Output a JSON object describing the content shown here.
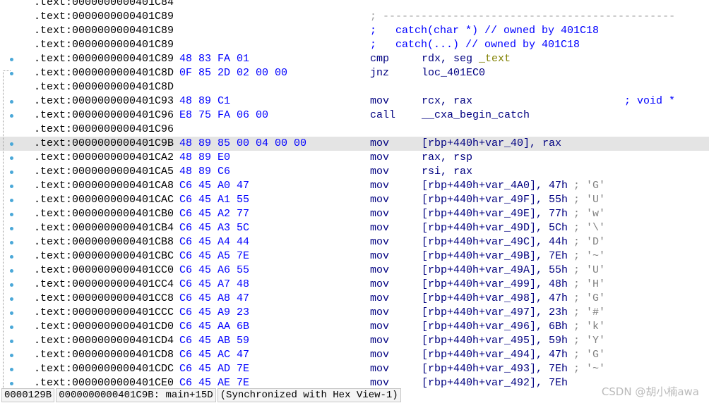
{
  "lines": [
    {
      "addr": ".text:0000000000401C84"
    },
    {
      "addr": ".text:0000000000401C89",
      "separator": "; ----------------------------------------------"
    },
    {
      "addr": ".text:0000000000401C89",
      "comment": ";   catch(char *) // owned by 401C18"
    },
    {
      "addr": ".text:0000000000401C89",
      "comment": ";   catch(...) // owned by 401C18"
    },
    {
      "addr": ".text:0000000000401C89",
      "bytes": "48 83 FA 01",
      "mnem": "cmp",
      "op1": "rdx, seg ",
      "op2": "_text",
      "bp": true
    },
    {
      "addr": ".text:0000000000401C8D",
      "bytes": "0F 85 2D 02 00 00",
      "mnem": "jnz",
      "op1": "loc_401EC0",
      "bp": true
    },
    {
      "addr": ".text:0000000000401C8D"
    },
    {
      "addr": ".text:0000000000401C93",
      "bytes": "48 89 C1",
      "mnem": "mov",
      "op1": "rcx, rax",
      "rcomment": "; void *",
      "bp": true
    },
    {
      "addr": ".text:0000000000401C96",
      "bytes": "E8 75 FA 06 00",
      "mnem": "call",
      "op1": "__cxa_begin_catch",
      "bp": true
    },
    {
      "addr": ".text:0000000000401C96"
    },
    {
      "addr": ".text:0000000000401C9B",
      "bytes": "48 89 85 00 04 00 00",
      "mnem": "mov",
      "op1": "[rbp+440h+var_40], rax",
      "bp": true,
      "selected": true
    },
    {
      "addr": ".text:0000000000401CA2",
      "bytes": "48 89 E0",
      "mnem": "mov",
      "op1": "rax, rsp",
      "bp": true
    },
    {
      "addr": ".text:0000000000401CA5",
      "bytes": "48 89 C6",
      "mnem": "mov",
      "op1": "rsi, rax",
      "bp": true
    },
    {
      "addr": ".text:0000000000401CA8",
      "bytes": "C6 45 A0 47",
      "mnem": "mov",
      "op1": "[rbp+440h+var_4A0], 47h",
      "ccomment": "; 'G'",
      "bp": true
    },
    {
      "addr": ".text:0000000000401CAC",
      "bytes": "C6 45 A1 55",
      "mnem": "mov",
      "op1": "[rbp+440h+var_49F], 55h",
      "ccomment": "; 'U'",
      "bp": true
    },
    {
      "addr": ".text:0000000000401CB0",
      "bytes": "C6 45 A2 77",
      "mnem": "mov",
      "op1": "[rbp+440h+var_49E], 77h",
      "ccomment": "; 'w'",
      "bp": true
    },
    {
      "addr": ".text:0000000000401CB4",
      "bytes": "C6 45 A3 5C",
      "mnem": "mov",
      "op1": "[rbp+440h+var_49D], 5Ch",
      "ccomment": "; '\\'",
      "bp": true
    },
    {
      "addr": ".text:0000000000401CB8",
      "bytes": "C6 45 A4 44",
      "mnem": "mov",
      "op1": "[rbp+440h+var_49C], 44h",
      "ccomment": "; 'D'",
      "bp": true
    },
    {
      "addr": ".text:0000000000401CBC",
      "bytes": "C6 45 A5 7E",
      "mnem": "mov",
      "op1": "[rbp+440h+var_49B], 7Eh",
      "ccomment": "; '~'",
      "bp": true
    },
    {
      "addr": ".text:0000000000401CC0",
      "bytes": "C6 45 A6 55",
      "mnem": "mov",
      "op1": "[rbp+440h+var_49A], 55h",
      "ccomment": "; 'U'",
      "bp": true
    },
    {
      "addr": ".text:0000000000401CC4",
      "bytes": "C6 45 A7 48",
      "mnem": "mov",
      "op1": "[rbp+440h+var_499], 48h",
      "ccomment": "; 'H'",
      "bp": true
    },
    {
      "addr": ".text:0000000000401CC8",
      "bytes": "C6 45 A8 47",
      "mnem": "mov",
      "op1": "[rbp+440h+var_498], 47h",
      "ccomment": "; 'G'",
      "bp": true
    },
    {
      "addr": ".text:0000000000401CCC",
      "bytes": "C6 45 A9 23",
      "mnem": "mov",
      "op1": "[rbp+440h+var_497], 23h",
      "ccomment": "; '#'",
      "bp": true
    },
    {
      "addr": ".text:0000000000401CD0",
      "bytes": "C6 45 AA 6B",
      "mnem": "mov",
      "op1": "[rbp+440h+var_496], 6Bh",
      "ccomment": "; 'k'",
      "bp": true
    },
    {
      "addr": ".text:0000000000401CD4",
      "bytes": "C6 45 AB 59",
      "mnem": "mov",
      "op1": "[rbp+440h+var_495], 59h",
      "ccomment": "; 'Y'",
      "bp": true
    },
    {
      "addr": ".text:0000000000401CD8",
      "bytes": "C6 45 AC 47",
      "mnem": "mov",
      "op1": "[rbp+440h+var_494], 47h",
      "ccomment": "; 'G'",
      "bp": true
    },
    {
      "addr": ".text:0000000000401CDC",
      "bytes": "C6 45 AD 7E",
      "mnem": "mov",
      "op1": "[rbp+440h+var_493], 7Eh",
      "ccomment": "; '~'",
      "bp": true
    },
    {
      "addr": ".text:0000000000401CE0",
      "bytes": "C6 45 AE 7E",
      "mnem": "mov",
      "op1": "[rbp+440h+var_492], 7Eh",
      "bp": true
    }
  ],
  "status": {
    "offset": "0000129B",
    "location": "0000000000401C9B: main+15D",
    "sync": "(Synchronized with Hex View-1)"
  },
  "watermark": "CSDN @胡小楠awa"
}
